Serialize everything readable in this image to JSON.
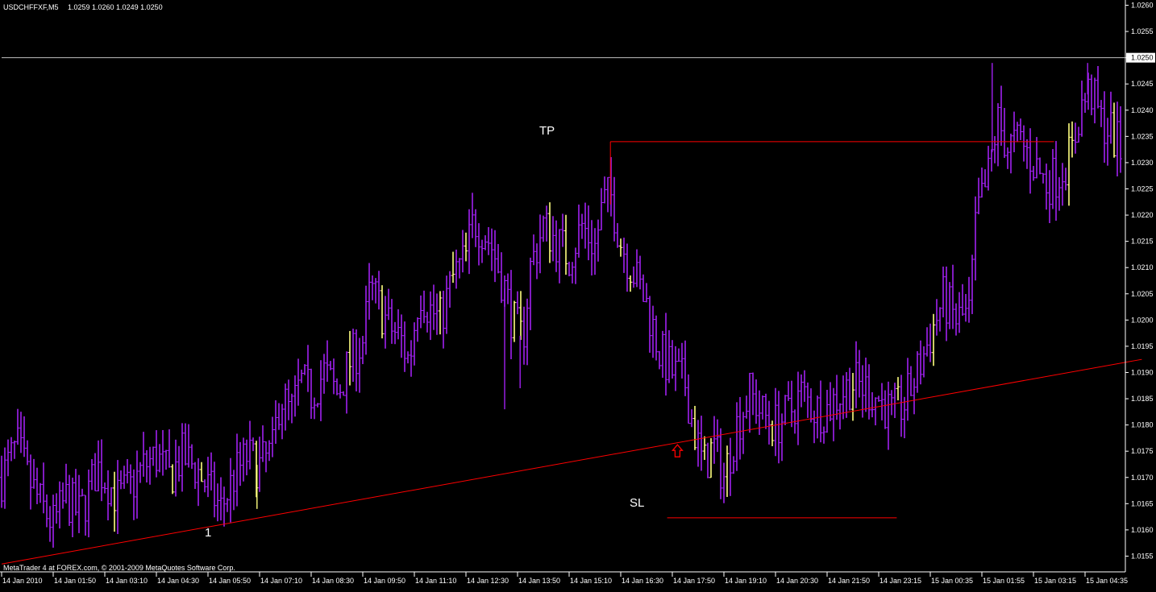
{
  "header": {
    "symbol": "USDCHFFXF,M5",
    "ohlc": "1.0259 1.0260 1.0249 1.0250"
  },
  "footer": {
    "copyright": "MetaTrader 4 at FOREX.com, © 2001-2009 MetaQuotes Software Corp."
  },
  "colors": {
    "background": "#000000",
    "bar_up": "#a020f0",
    "bar_doji": "#ffff80",
    "trendline": "#ff0000",
    "axis": "#ffffff",
    "current_price_line": "#c0c0c0"
  },
  "annotations": {
    "tp": "TP",
    "sl": "SL",
    "point_1": "1"
  },
  "chart_data": {
    "type": "ohlc",
    "ylim": [
      1.0152,
      1.0261
    ],
    "y_ticks": [
      "1.0260",
      "1.0255",
      "1.0250",
      "1.0245",
      "1.0240",
      "1.0235",
      "1.0230",
      "1.0225",
      "1.0220",
      "1.0215",
      "1.0210",
      "1.0205",
      "1.0200",
      "1.0195",
      "1.0190",
      "1.0185",
      "1.0180",
      "1.0175",
      "1.0170",
      "1.0165",
      "1.0160",
      "1.0155"
    ],
    "current_price": "1.0250",
    "x_ticks": [
      "14 Jan 2010",
      "14 Jan 01:50",
      "14 Jan 03:10",
      "14 Jan 04:30",
      "14 Jan 05:50",
      "14 Jan 07:10",
      "14 Jan 08:30",
      "14 Jan 09:50",
      "14 Jan 11:10",
      "14 Jan 12:30",
      "14 Jan 13:50",
      "14 Jan 15:10",
      "14 Jan 16:30",
      "14 Jan 17:50",
      "14 Jan 19:10",
      "14 Jan 20:30",
      "14 Jan 21:50",
      "14 Jan 23:15",
      "15 Jan 00:35",
      "15 Jan 01:55",
      "15 Jan 03:15",
      "15 Jan 04:35"
    ],
    "close_path": [
      [
        0,
        1.017
      ],
      [
        0.6,
        1.0176
      ],
      [
        1.0,
        1.017
      ],
      [
        1.5,
        1.0165
      ],
      [
        2.0,
        1.0161
      ],
      [
        2.5,
        1.0166
      ],
      [
        3.0,
        1.0163
      ],
      [
        3.3,
        1.0166
      ],
      [
        3.7,
        1.0172
      ],
      [
        4.0,
        1.017
      ],
      [
        4.5,
        1.0166
      ],
      [
        5.0,
        1.0168
      ],
      [
        5.5,
        1.0172
      ],
      [
        6.0,
        1.0174
      ],
      [
        6.5,
        1.017
      ],
      [
        7.0,
        1.0174
      ],
      [
        7.5,
        1.0172
      ],
      [
        8.0,
        1.0168
      ],
      [
        8.5,
        1.0164
      ],
      [
        9.0,
        1.017
      ],
      [
        9.5,
        1.0174
      ],
      [
        10.0,
        1.0172
      ],
      [
        10.5,
        1.0175
      ],
      [
        10.8,
        1.0186
      ],
      [
        11.2,
        1.0182
      ],
      [
        11.6,
        1.0188
      ],
      [
        12.0,
        1.0186
      ],
      [
        12.5,
        1.019
      ],
      [
        13.0,
        1.0186
      ],
      [
        13.5,
        1.0192
      ],
      [
        14.0,
        1.0196
      ],
      [
        14.3,
        1.0206
      ],
      [
        14.7,
        1.0202
      ],
      [
        15.0,
        1.0199
      ],
      [
        15.5,
        1.0196
      ],
      [
        15.8,
        1.0192
      ],
      [
        16.2,
        1.0206
      ],
      [
        16.6,
        1.0202
      ],
      [
        17.0,
        1.02
      ],
      [
        17.5,
        1.0208
      ],
      [
        18.0,
        1.0212
      ],
      [
        18.3,
        1.0219
      ],
      [
        18.7,
        1.0217
      ],
      [
        19.0,
        1.0214
      ],
      [
        19.5,
        1.0206
      ],
      [
        19.8,
        1.02
      ],
      [
        20.2,
        1.0196
      ],
      [
        20.5,
        1.021
      ],
      [
        21.0,
        1.0218
      ],
      [
        21.5,
        1.0215
      ],
      [
        22.0,
        1.0212
      ],
      [
        22.5,
        1.0218
      ],
      [
        23.0,
        1.0214
      ],
      [
        23.3,
        1.0222
      ],
      [
        23.6,
        1.0224
      ],
      [
        24.0,
        1.0215
      ],
      [
        24.5,
        1.0209
      ],
      [
        25.0,
        1.0203
      ],
      [
        25.5,
        1.0194
      ],
      [
        26.0,
        1.019
      ],
      [
        26.5,
        1.0188
      ],
      [
        26.8,
        1.018
      ],
      [
        27.2,
        1.0172
      ],
      [
        27.6,
        1.0176
      ],
      [
        28.0,
        1.017
      ],
      [
        28.5,
        1.018
      ],
      [
        29.0,
        1.0186
      ],
      [
        29.5,
        1.0182
      ],
      [
        30.0,
        1.018
      ],
      [
        30.5,
        1.0182
      ],
      [
        31.0,
        1.0186
      ],
      [
        31.5,
        1.0183
      ],
      [
        32.0,
        1.0183
      ],
      [
        32.5,
        1.0186
      ],
      [
        33.0,
        1.0188
      ],
      [
        33.5,
        1.0187
      ],
      [
        34.0,
        1.0185
      ],
      [
        34.5,
        1.0182
      ],
      [
        35.0,
        1.0184
      ],
      [
        35.5,
        1.019
      ],
      [
        36.0,
        1.0197
      ],
      [
        36.5,
        1.0204
      ],
      [
        37.0,
        1.02
      ],
      [
        37.5,
        1.0201
      ],
      [
        37.8,
        1.022
      ],
      [
        38.2,
        1.0226
      ],
      [
        38.6,
        1.0238
      ],
      [
        39.0,
        1.0233
      ],
      [
        39.5,
        1.0234
      ],
      [
        40.0,
        1.023
      ],
      [
        40.5,
        1.0226
      ],
      [
        41.0,
        1.0228
      ],
      [
        41.5,
        1.0232
      ],
      [
        41.8,
        1.024
      ],
      [
        42.2,
        1.0244
      ],
      [
        42.6,
        1.0238
      ],
      [
        43.0,
        1.0236
      ],
      [
        43.4,
        1.0232
      ]
    ],
    "spikes": [
      {
        "x": 9.9,
        "low": 1.0164
      },
      {
        "x": 19.5,
        "low": 1.0183
      },
      {
        "x": 20.1,
        "low": 1.0187
      },
      {
        "x": 38.4,
        "high": 1.0249
      },
      {
        "x": 42.1,
        "high": 1.0249
      }
    ],
    "lines": {
      "trendline": {
        "from": [
          0,
          1.01535
        ],
        "to": [
          44.2,
          1.01925
        ]
      },
      "tp": {
        "from": [
          23.6,
          1.0234
        ],
        "to": [
          40.8,
          1.0234
        ]
      },
      "sl": {
        "from": [
          25.8,
          1.01623
        ],
        "to": [
          34.7,
          1.01623
        ]
      }
    },
    "arrow_up": {
      "x": 26.2,
      "y": 1.0175
    }
  }
}
